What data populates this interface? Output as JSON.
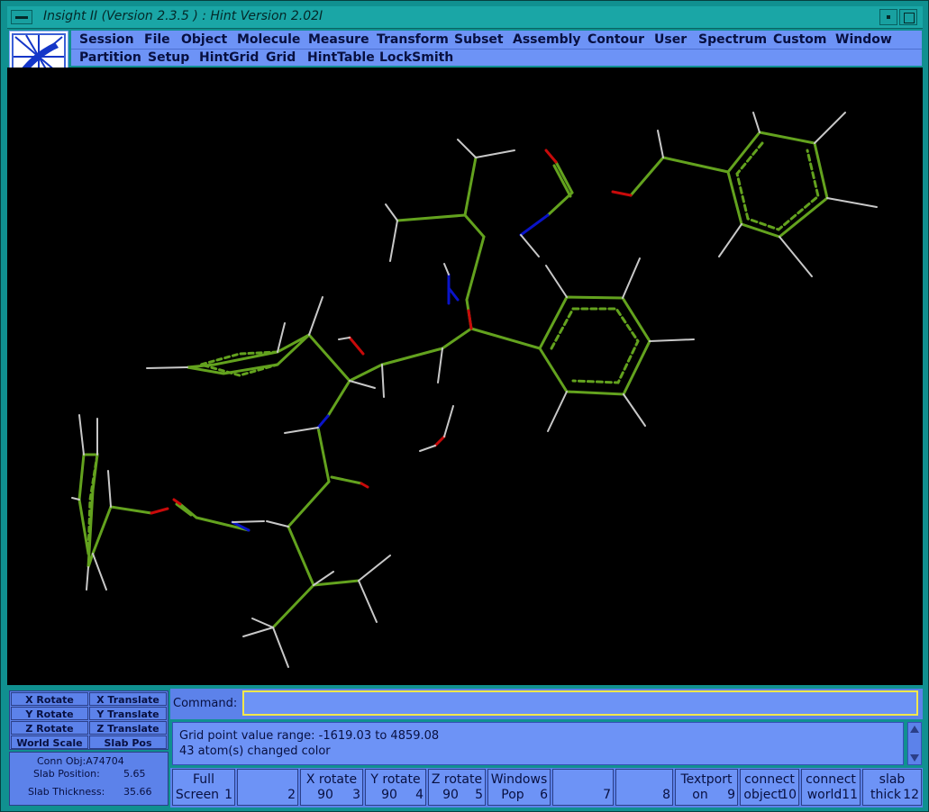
{
  "window": {
    "title": "Insight II (Version 2.3.5 ) : Hint  Version 2.02I"
  },
  "menu_row1": [
    "Session",
    "File",
    "Object",
    "Molecule",
    "Measure",
    "Transform",
    "Subset",
    "Assembly",
    "Contour",
    "User",
    "Spectrum",
    "Custom",
    "Window"
  ],
  "menu_row2": [
    "Partition",
    "Setup",
    "HintGrid",
    "Grid",
    "HintTable",
    "LockSmith"
  ],
  "controls": {
    "x_rotate": "X Rotate",
    "x_translate": "X Translate",
    "y_rotate": "Y Rotate",
    "y_translate": "Y Translate",
    "z_rotate": "Z Rotate",
    "z_translate": "Z Translate",
    "world_scale": "World Scale",
    "slab_pos": "Slab Pos"
  },
  "status": {
    "conn_obj": "Conn Obj:A74704",
    "slab_position_label": "Slab Position:",
    "slab_position_value": "5.65",
    "slab_thickness_label": "Slab Thickness:",
    "slab_thickness_value": "35.66"
  },
  "command": {
    "label": "Command:",
    "value": ""
  },
  "messages": [
    "Grid point value range: -1619.03 to 4859.08",
    "43 atom(s) changed color"
  ],
  "fkeys": [
    {
      "l1": "Full",
      "l2": "Screen",
      "num": "1"
    },
    {
      "l1": "",
      "l2": "",
      "num": "2"
    },
    {
      "l1": "X rotate",
      "l2": "90",
      "num": "3"
    },
    {
      "l1": "Y rotate",
      "l2": "90",
      "num": "4"
    },
    {
      "l1": "Z rotate",
      "l2": "90",
      "num": "5"
    },
    {
      "l1": "Windows",
      "l2": "Pop",
      "num": "6"
    },
    {
      "l1": "",
      "l2": "",
      "num": "7"
    },
    {
      "l1": "",
      "l2": "",
      "num": "8"
    },
    {
      "l1": "Textport",
      "l2": "on",
      "num": "9"
    },
    {
      "l1": "connect",
      "l2": "object",
      "num": "10"
    },
    {
      "l1": "connect",
      "l2": "world",
      "num": "11"
    },
    {
      "l1": "slab",
      "l2": "thick",
      "num": "12"
    }
  ],
  "colors": {
    "carbon": "#63a21e",
    "nitrogen": "#0a14c8",
    "oxygen": "#c80a0a",
    "hydrogen": "#c8c8c8",
    "background": "#000000"
  }
}
